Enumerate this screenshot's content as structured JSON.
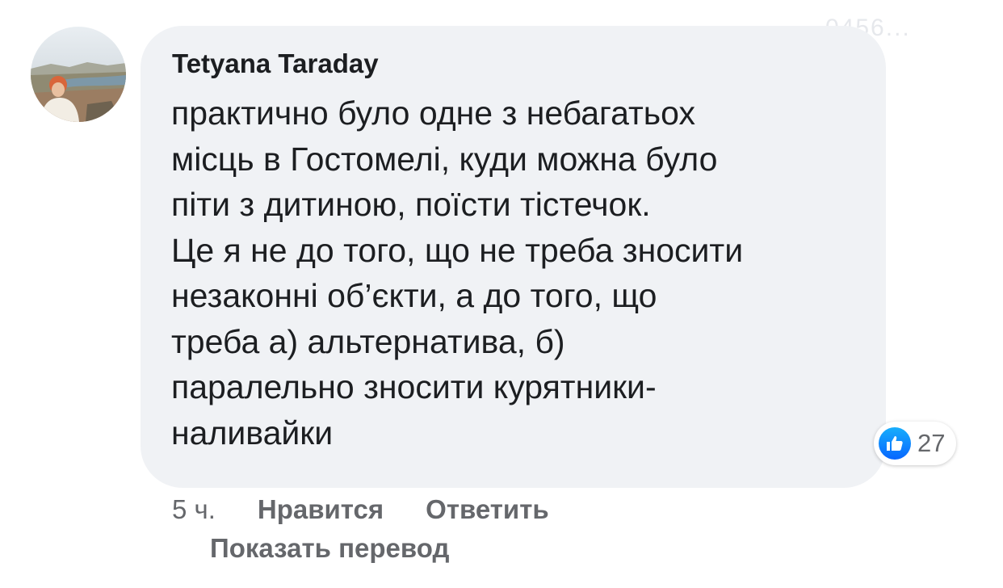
{
  "watermark": "0456...",
  "comment": {
    "author": "Tetyana Taraday",
    "text": "практично було одне з небагатьох\nмісць в Гостомелі, куди можна було\nпіти з дитиною, поїсти тістечок.\nЦе я не до того, що не треба зносити\nнезаконні об’єкти, а до того, що\nтреба а) альтернатива, б)\nпаралельно зносити курятники-\nналивайки",
    "reactions": {
      "icon": "like-icon",
      "count": "27",
      "color": "#0866ff"
    },
    "time": "5 ч.",
    "like_label": "Нравится",
    "reply_label": "Ответить",
    "translate_label": "Показать перевод"
  },
  "colors": {
    "bubble": "#f0f2f5",
    "text": "#1c1e21",
    "meta": "#65676b"
  }
}
